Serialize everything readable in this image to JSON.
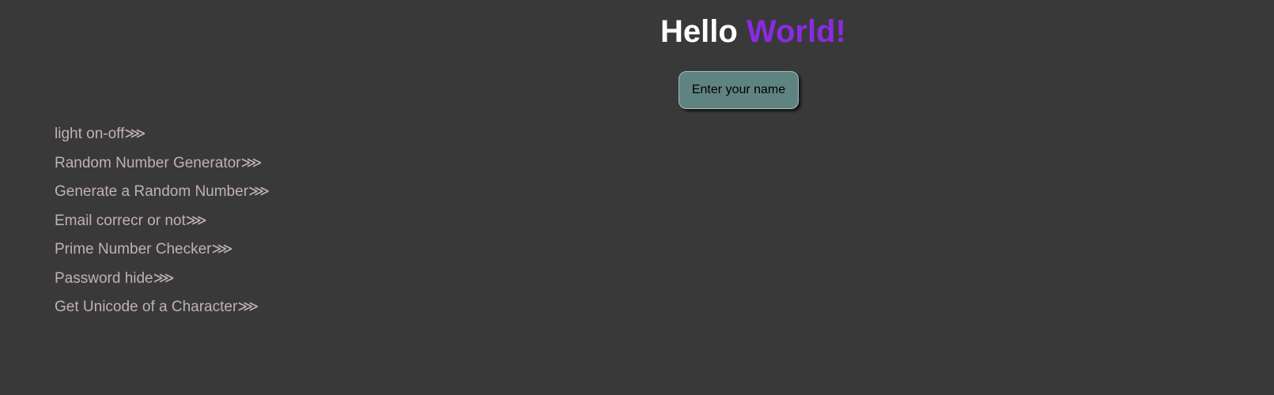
{
  "header": {
    "title_part1": "Hello ",
    "title_part2": "World!",
    "name_button_label": "Enter your name"
  },
  "nav": {
    "arrow_glyph": "⋙",
    "items": [
      {
        "label": "light on-off"
      },
      {
        "label": "Random Number Generator"
      },
      {
        "label": "Generate a Random Number"
      },
      {
        "label": "Email correcr or not"
      },
      {
        "label": "Prime Number Checker"
      },
      {
        "label": "Password hide"
      },
      {
        "label": "Get Unicode of a Character"
      }
    ]
  },
  "colors": {
    "background": "#393939",
    "title": "#ffffff",
    "accent": "#8a2be2",
    "button_bg": "#5f8380",
    "link_text": "#c1b1b1"
  }
}
